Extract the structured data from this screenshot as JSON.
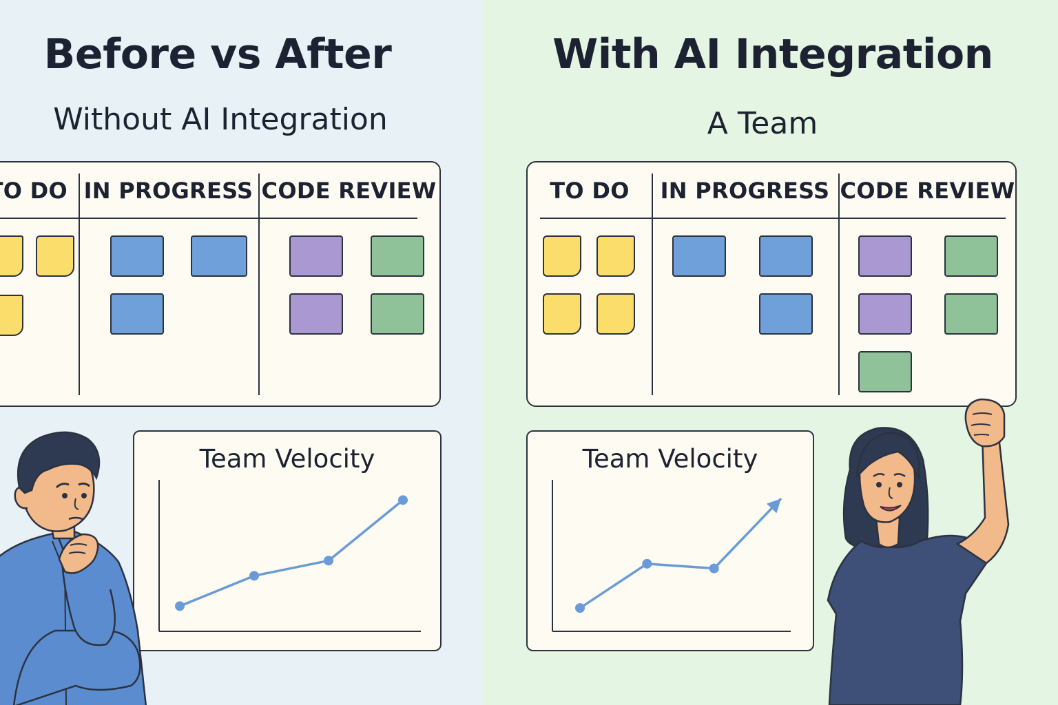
{
  "before": {
    "title": "Before vs After",
    "subtitle": "Without AI Integration",
    "board": {
      "columns": [
        {
          "label": "TO DO",
          "cards": [
            "yellow",
            "yellow",
            "yellow"
          ]
        },
        {
          "label": "IN PROGRESS",
          "cards": [
            "blue",
            "blue",
            "blue"
          ]
        },
        {
          "label": "CODE REVIEW",
          "cards": [
            "purple",
            "green",
            "purple",
            "green"
          ]
        }
      ]
    },
    "chart_data": {
      "type": "line",
      "title": "Team Velocity",
      "x": [
        1,
        2,
        3,
        4
      ],
      "y": [
        1,
        2.2,
        2.8,
        5.2
      ],
      "ylim": [
        0,
        6
      ],
      "axis_tick_labels": false,
      "grid": false,
      "color": "#6a9bd8"
    }
  },
  "after": {
    "title": "With AI Integration",
    "subtitle": "A Team",
    "board": {
      "columns": [
        {
          "label": "TO DO",
          "cards": [
            "yellow",
            "yellow",
            "yellow",
            "yellow"
          ]
        },
        {
          "label": "IN PROGRESS",
          "cards": [
            "blue",
            "blue",
            "blue"
          ]
        },
        {
          "label": "CODE REVIEW",
          "cards": [
            "purple",
            "green",
            "purple",
            "green",
            "green"
          ]
        }
      ]
    },
    "chart_data": {
      "type": "line",
      "title": "Team Velocity",
      "x": [
        1,
        2,
        3,
        4
      ],
      "y": [
        1,
        2.9,
        2.7,
        5.7
      ],
      "ylim": [
        0,
        6.5
      ],
      "end_marker": "arrow",
      "axis_tick_labels": false,
      "grid": false,
      "color": "#6a9bd8"
    }
  },
  "colors": {
    "left_background": "#e8f1f6",
    "right_background": "#e4f5e3",
    "card_yellow": "#fbdd6b",
    "card_blue": "#6fa0d9",
    "card_purple": "#a998d2",
    "card_green": "#8fc298",
    "outline": "#2c3240"
  },
  "figures": {
    "left": "thinking-man-icon",
    "right": "cheering-woman-icon"
  }
}
